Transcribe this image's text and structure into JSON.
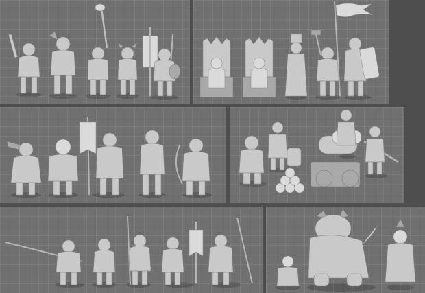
{
  "panels": [
    {
      "id": "vikings",
      "subject": "viking-warriors-group"
    },
    {
      "id": "royals",
      "subject": "royal-court-group"
    },
    {
      "id": "villagers",
      "subject": "villagers-and-archers-group"
    },
    {
      "id": "artillery",
      "subject": "cannon-crew-group"
    },
    {
      "id": "valkyries",
      "subject": "warrior-women-group"
    },
    {
      "id": "troll",
      "subject": "troll-and-gnomes-group"
    }
  ],
  "colors": {
    "background": "#4e4e4e",
    "panel": "#707070",
    "figure": "#c9c9c9"
  }
}
